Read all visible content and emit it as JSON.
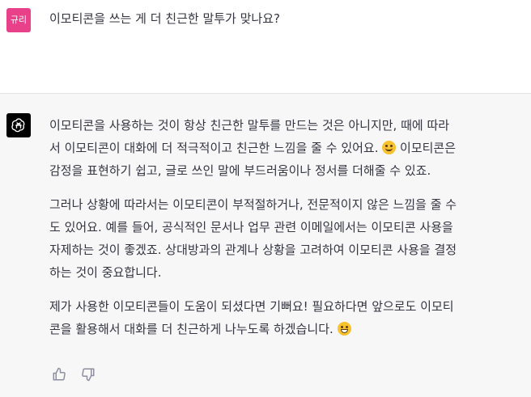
{
  "user": {
    "avatar_label": "규리",
    "avatar_color": "#e8418a",
    "message": "이모티콘을 쓰는 게 더 친근한 말투가 맞나요?"
  },
  "assistant": {
    "avatar_icon": "openai-logo-icon",
    "paragraphs": [
      {
        "lines": [
          "이모티콘을 사용하는 것이 항상 친근한 말투를 만드는 것은 아니지만, 때에 따라",
          "서 이모티콘이 대화에 더 적극적이고 친근한 느낌을 줄 수 있어요. ",
          "감정을 표현하기 쉽고, 글로 쓰인 말에 부드러움이나 정서를 더해줄 수 있죠."
        ],
        "line2_tail": " 이모티콘은"
      },
      {
        "lines": [
          "그러나 상황에 따라서는 이모티콘이 부적절하거나, 전문적이지 않은 느낌을 줄 수",
          "도 있어요. 예를 들어, 공식적인 문서나 업무 관련 이메일에서는 이모티콘 사용을",
          "자제하는 것이 좋겠죠. 상대방과의 관계나 상황을 고려하여 이모티콘 사용을 결정",
          "하는 것이 중요합니다."
        ]
      },
      {
        "lines": [
          "제가 사용한 이모티콘들이 도움이 되셨다면 기뻐요! 필요하다면 앞으로도 이모티",
          "콘을 활용해서 대화를 더 친근하게 나누도록 하겠습니다. "
        ]
      }
    ],
    "emojis": [
      "smiling-face-emoji",
      "grinning-face-emoji"
    ]
  },
  "feedback": {
    "thumbs_up_icon": "thumbs-up-icon",
    "thumbs_down_icon": "thumbs-down-icon"
  }
}
